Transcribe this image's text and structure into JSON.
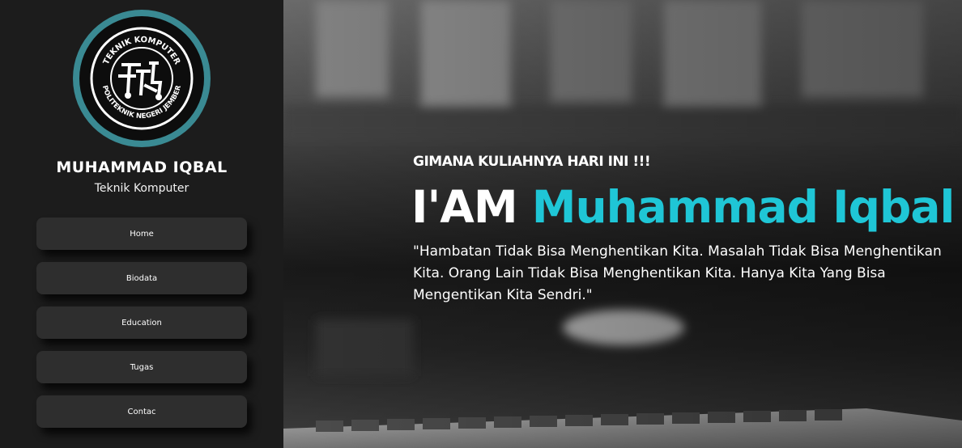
{
  "sidebar": {
    "logo": {
      "top_text": "TEKNIK KOMPUTER",
      "bottom_text": "POLITEKNIK NEGERI JEMBER",
      "ring_color": "#3a8a93"
    },
    "name": "MUHAMMAD IQBAL",
    "subtitle": "Teknik Komputer",
    "nav": [
      {
        "label": "Home"
      },
      {
        "label": "Biodata"
      },
      {
        "label": "Education"
      },
      {
        "label": "Tugas"
      },
      {
        "label": "Contac"
      }
    ]
  },
  "hero": {
    "tagline": "GIMANA KULIAHNYA HARI INI !!!",
    "headline_prefix": "I'AM ",
    "headline_name": "Muhammad Iqbal",
    "quote": "\"Hambatan Tidak Bisa Menghentikan Kita. Masalah Tidak Bisa Menghentikan Kita. Orang Lain Tidak Bisa Menghentikan Kita. Hanya Kita Yang Bisa Mengentikan Kita Sendri.\"",
    "accent_color": "#1fc6d6"
  }
}
